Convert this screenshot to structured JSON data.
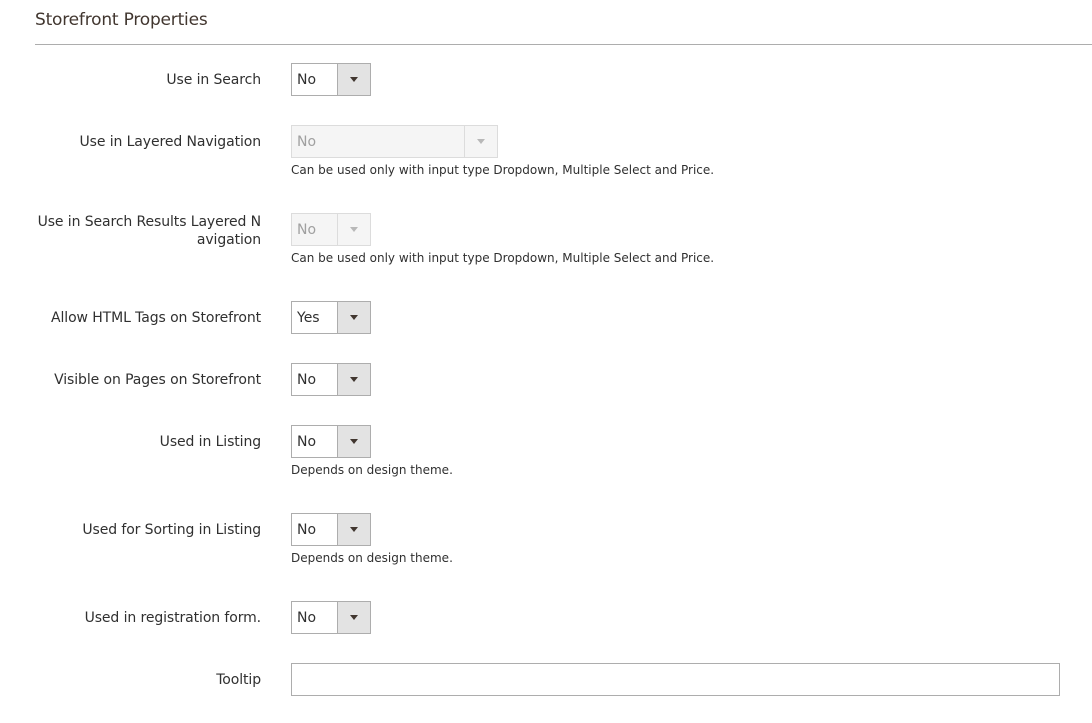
{
  "section": {
    "title": "Storefront Properties"
  },
  "fields": {
    "use_in_search": {
      "label": "Use in Search",
      "value": "No"
    },
    "use_in_layered_navigation": {
      "label": "Use in Layered Navigation",
      "value": "No",
      "note": "Can be used only with input type Dropdown, Multiple Select and Price."
    },
    "use_in_search_results_layered_navigation": {
      "label_line1": "Use in Search Results Layered N",
      "label_line2": "avigation",
      "value": "No",
      "note": "Can be used only with input type Dropdown, Multiple Select and Price."
    },
    "allow_html_tags": {
      "label": "Allow HTML Tags on Storefront",
      "value": "Yes"
    },
    "visible_on_pages": {
      "label": "Visible on Pages on Storefront",
      "value": "No"
    },
    "used_in_listing": {
      "label": "Used in Listing",
      "value": "No",
      "note": "Depends on design theme."
    },
    "used_for_sorting": {
      "label": "Used for Sorting in Listing",
      "value": "No",
      "note": "Depends on design theme."
    },
    "used_in_registration": {
      "label": "Used in registration form.",
      "value": "No"
    },
    "tooltip": {
      "label": "Tooltip",
      "value": ""
    }
  },
  "icons": {
    "select_arrow": "chevron-down-icon"
  }
}
